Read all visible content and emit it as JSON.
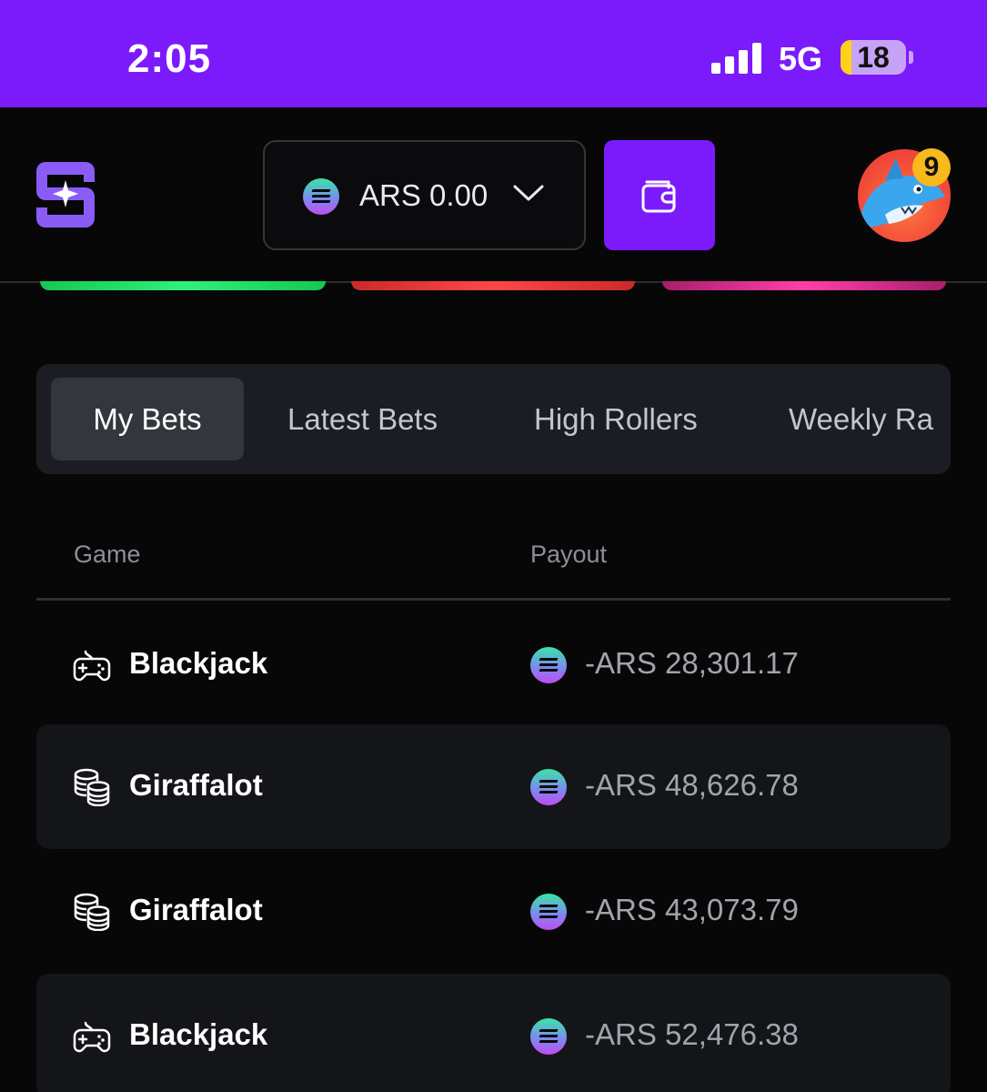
{
  "status_bar": {
    "time": "2:05",
    "network": "5G",
    "battery": "18"
  },
  "header": {
    "balance_display": "ARS 0.00",
    "notification_count": "9"
  },
  "bets": {
    "tabs": [
      {
        "label": "My Bets",
        "active": true
      },
      {
        "label": "Latest Bets",
        "active": false
      },
      {
        "label": "High Rollers",
        "active": false
      },
      {
        "label": "Weekly Ra",
        "active": false
      }
    ],
    "columns": {
      "game": "Game",
      "payout": "Payout"
    },
    "rows": [
      {
        "game": "Blackjack",
        "icon": "gamepad-icon",
        "payout": "-ARS 28,301.17"
      },
      {
        "game": "Giraffalot",
        "icon": "coins-stack-icon",
        "payout": "-ARS 48,626.78"
      },
      {
        "game": "Giraffalot",
        "icon": "coins-stack-icon",
        "payout": "-ARS 43,073.79"
      },
      {
        "game": "Blackjack",
        "icon": "gamepad-icon",
        "payout": "-ARS 52,476.38"
      }
    ]
  },
  "colors": {
    "accent": "#7b1bfb",
    "background": "#070708",
    "tab_bar": "#1b1d22",
    "badge": "#f8b91c"
  }
}
